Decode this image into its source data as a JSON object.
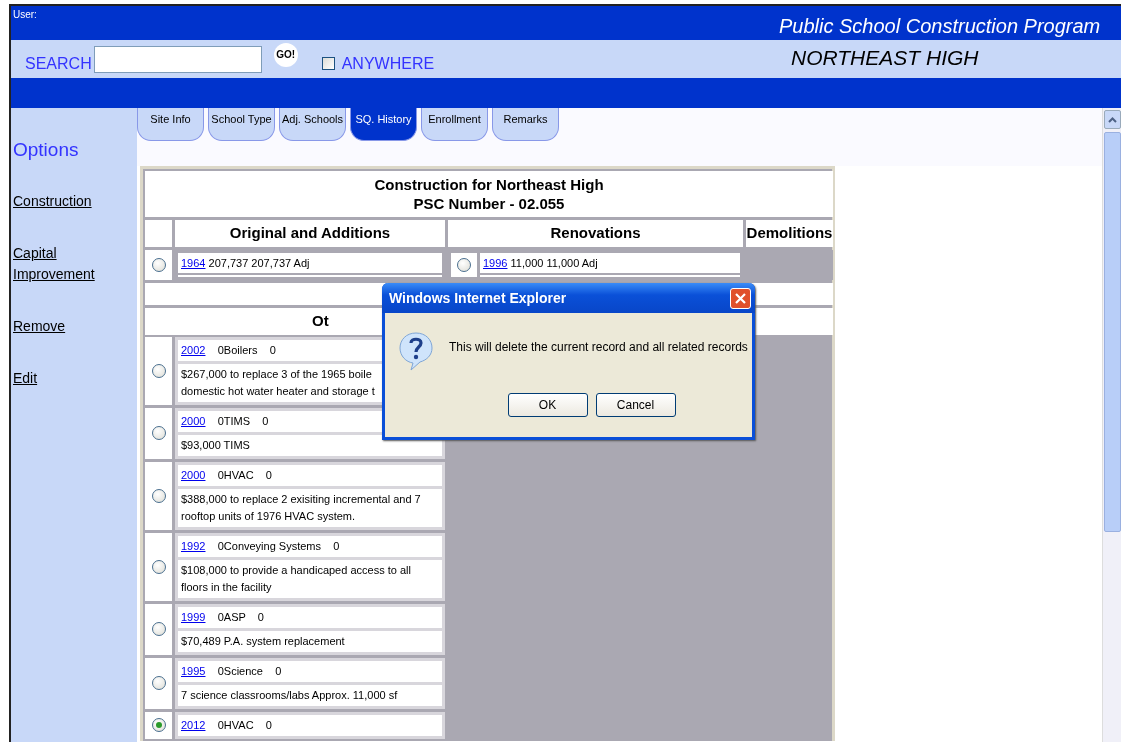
{
  "header": {
    "user_label": "User:",
    "title": "Public School Construction Program",
    "school_name": "NORTHEAST HIGH"
  },
  "search": {
    "label": "SEARCH",
    "go_button": "GO!",
    "anywhere": {
      "label": "ANYWHERE",
      "checked": false
    }
  },
  "tabs": [
    {
      "label": "Site Info",
      "selected": false
    },
    {
      "label": "School Type",
      "selected": false
    },
    {
      "label": "Adj. Schools",
      "selected": false
    },
    {
      "label": "SQ. History",
      "selected": true
    },
    {
      "label": "Enrollment",
      "selected": false
    },
    {
      "label": "Remarks",
      "selected": false
    }
  ],
  "sidebar": {
    "title": "Options",
    "items": [
      "Construction",
      "Capital Improvement",
      "Remove",
      "Edit"
    ]
  },
  "construction": {
    "title": "Construction for Northeast High",
    "subtitle": "PSC Number - 02.055",
    "columns": [
      "Original and Additions",
      "Renovations",
      "Demolitions"
    ],
    "original": [
      {
        "year": "1964",
        "area": "207,737",
        "area_adj": "207,737 Adj",
        "selected": false
      }
    ],
    "renovations": [
      {
        "year": "1996",
        "area": "11,000",
        "area_adj": "11,000 Adj",
        "selected": false
      }
    ],
    "other_heading": "Ot",
    "records": [
      {
        "year": "2002",
        "category": "0Boilers",
        "amount": "0",
        "description": [
          "$267,000 to replace 3 of the 1965 boile",
          "domestic hot water heater and storage t"
        ],
        "selected": false
      },
      {
        "year": "2000",
        "category": "0TIMS",
        "amount": "0",
        "description": [
          "$93,000 TIMS"
        ],
        "selected": false
      },
      {
        "year": "2000",
        "category": "0HVAC",
        "amount": "0",
        "description": [
          "$388,000 to replace 2 exisiting incremental and 7",
          "rooftop units of 1976 HVAC system."
        ],
        "selected": false
      },
      {
        "year": "1992",
        "category": "0Conveying Systems",
        "amount": "0",
        "description": [
          "$108,000 to provide a handicaped access to all",
          "floors in the facility"
        ],
        "selected": false
      },
      {
        "year": "1999",
        "category": "0ASP",
        "amount": "0",
        "description": [
          "$70,489 P.A. system replacement"
        ],
        "selected": false
      },
      {
        "year": "1995",
        "category": "0Science",
        "amount": "0",
        "description": [
          "7 science classrooms/labs Approx. 11,000 sf"
        ],
        "selected": false
      },
      {
        "year": "2012",
        "category": "0HVAC",
        "amount": "0",
        "selected": true
      }
    ]
  },
  "dialog": {
    "title": "Windows Internet Explorer",
    "message": "This will delete the current record and all related records",
    "buttons": [
      "OK",
      "Cancel"
    ]
  }
}
